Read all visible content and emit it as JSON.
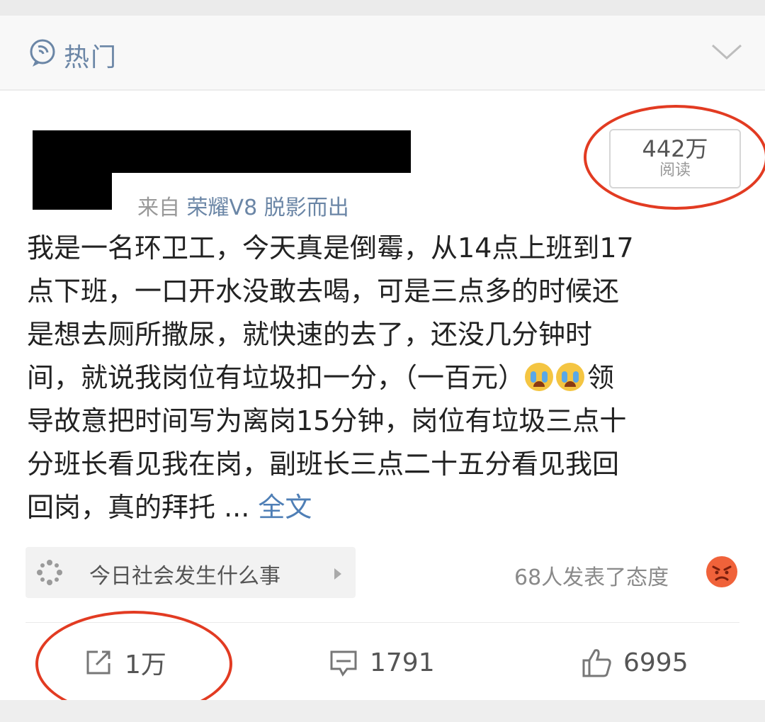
{
  "header": {
    "title": "热门",
    "icon": "hot-icon",
    "collapse_icon": "chevron-down-icon"
  },
  "post": {
    "source_prefix": "来自",
    "source_device": "荣耀V8 脱影而出",
    "reads": {
      "value": "442万",
      "label": "阅读"
    },
    "text_lines": [
      "我是一名环卫工，今天真是倒霉，从14点上班到17",
      "点下班，一口开水没敢去喝，可是三点多的时候还",
      "是想去厕所撒尿，就快速的去了，还没几分钟时",
      "间，就说我岗位有垃圾扣一分，（一百元）",
      "导故意把时间写为离岗15分钟，岗位有垃圾三点十",
      "分班长看见我在岗，副班长三点二十五分看见我回",
      "回岗，真的拜托 ... "
    ],
    "line4_tail": "领",
    "emoji": [
      "cry-emoji",
      "cry-emoji"
    ],
    "full_text_link": "全文",
    "topic": {
      "label": "今日社会发生什么事",
      "icon": "topic-icon"
    },
    "attitude": {
      "text": "68人发表了态度",
      "icon": "angry-emoji"
    }
  },
  "actions": {
    "repost": {
      "count": "1万",
      "icon": "repost-icon"
    },
    "comment": {
      "count": "1791",
      "icon": "comment-icon"
    },
    "like": {
      "count": "6995",
      "icon": "like-icon"
    }
  },
  "colors": {
    "accent": "#6b86a6",
    "link": "#4f7fb6",
    "annotation": "#e23b22",
    "emoji": "#f4c542"
  }
}
